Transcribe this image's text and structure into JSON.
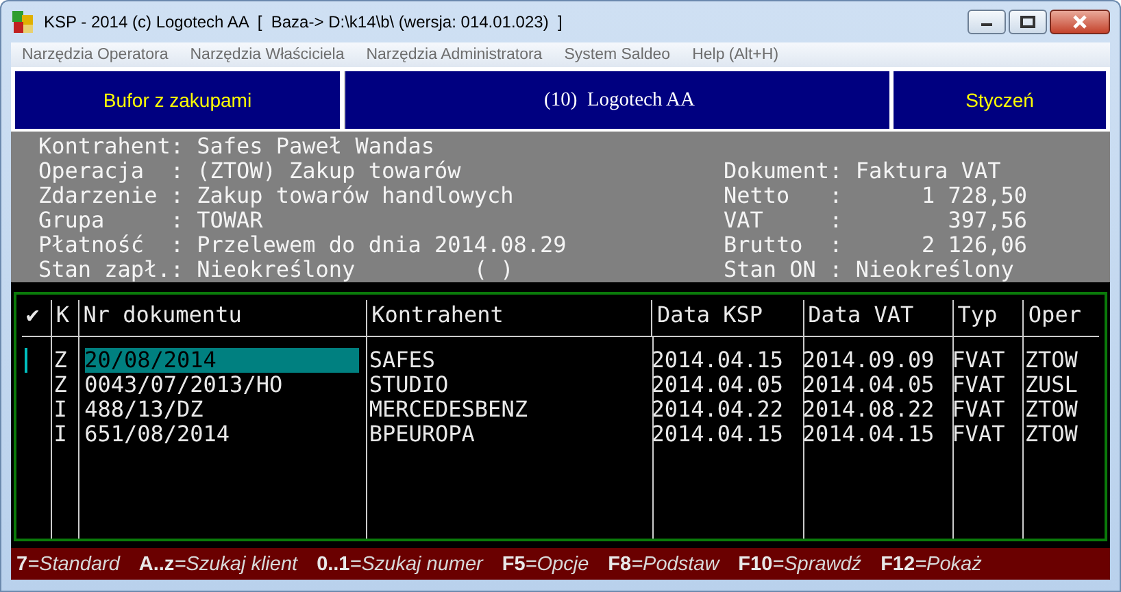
{
  "window": {
    "title": "KSP - 2014 (c) Logotech AA  [  Baza-> D:\\k14\\b\\ (wersja: 014.01.023)  ]"
  },
  "menu": [
    "Narzędzia Operatora",
    "Narzędzia Właściciela",
    "Narzędzia Administratora",
    "System Saldeo",
    "Help (Alt+H)"
  ],
  "header": {
    "left": "Bufor z zakupami",
    "center": "(10)  Logotech AA",
    "right": "Styczeń"
  },
  "info_left": [
    "Kontrahent: Safes Paweł Wandas",
    "Operacja  : (ZTOW) Zakup towarów",
    "Zdarzenie : Zakup towarów handlowych",
    "Grupa     : TOWAR",
    "Płatność  : Przelewem do dnia 2014.08.29",
    "Stan zapł.: Nieokreślony         ( )"
  ],
  "info_right": [
    "Dokument: Faktura VAT",
    "Netto   :      1 728,50",
    "VAT     :        397,56",
    "Brutto  :      2 126,06",
    "Stan ON : Nieokreślony"
  ],
  "table": {
    "columns": [
      "✔",
      "K",
      "Nr dokumentu",
      "Kontrahent",
      "Data KSP",
      "Data VAT",
      "Typ",
      "Oper"
    ],
    "rows": [
      {
        "selected": true,
        "cells": [
          "",
          "Z",
          "20/08/2014",
          "SAFES",
          "2014.04.15",
          "2014.09.09",
          "FVAT",
          "ZTOW"
        ]
      },
      {
        "selected": false,
        "cells": [
          "",
          "Z",
          "0043/07/2013/HO",
          "STUDIO",
          "2014.04.05",
          "2014.04.05",
          "FVAT",
          "ZUSL"
        ]
      },
      {
        "selected": false,
        "cells": [
          "",
          "I",
          "488/13/DZ",
          "MERCEDESBENZ",
          "2014.04.22",
          "2014.08.22",
          "FVAT",
          "ZTOW"
        ]
      },
      {
        "selected": false,
        "cells": [
          "",
          "I",
          "651/08/2014",
          "BPEUROPA",
          "2014.04.15",
          "2014.04.15",
          "FVAT",
          "ZTOW"
        ]
      }
    ]
  },
  "status_bar": [
    {
      "key": "7",
      "label": "=Standard"
    },
    {
      "key": "A..z",
      "label": "=Szukaj klient"
    },
    {
      "key": "0..1",
      "label": "=Szukaj numer"
    },
    {
      "key": "F5",
      "label": "=Opcje"
    },
    {
      "key": "F8",
      "label": "=Podstaw"
    },
    {
      "key": "F10",
      "label": "=Sprawdź"
    },
    {
      "key": "F12",
      "label": "=Pokaż"
    }
  ]
}
